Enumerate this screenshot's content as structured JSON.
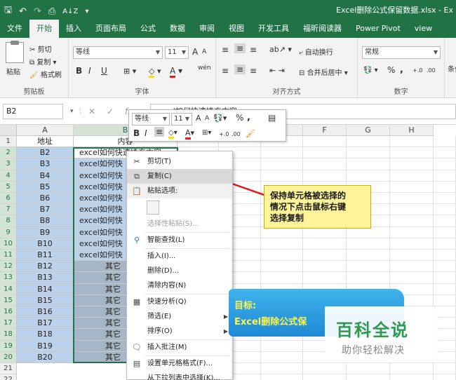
{
  "window": {
    "title": "Excel删除公式保留数据.xlsx - Ex"
  },
  "quick_access": {
    "save": "🖫",
    "undo": "↶",
    "redo": "↷",
    "preview": "⎙",
    "sort": "A↓Z",
    "more": "▾"
  },
  "tabs": [
    "文件",
    "开始",
    "插入",
    "页面布局",
    "公式",
    "数据",
    "审阅",
    "视图",
    "开发工具",
    "福昕阅读器",
    "Power Pivot",
    "view"
  ],
  "active_tab": 1,
  "ribbon": {
    "clipboard": {
      "paste": "粘贴",
      "cut": "剪切",
      "copy": "复制",
      "format_painter": "格式刷",
      "label": "剪贴板"
    },
    "font": {
      "name": "等线",
      "size": "11",
      "grow": "A",
      "shrink": "A",
      "bold": "B",
      "italic": "I",
      "underline": "U",
      "wen": "wén",
      "label": "字体"
    },
    "alignment": {
      "wrap": "自动换行",
      "merge": "合并后居中",
      "label": "对齐方式"
    },
    "number": {
      "format": "常规",
      "percent": "%",
      "comma": ",",
      "label": "数字"
    },
    "styles": {
      "cond": "条件"
    }
  },
  "formula_bar": {
    "name_box": "B2",
    "content": "excel如何快速填充内容"
  },
  "columns": [
    "A",
    "B",
    "C",
    "D",
    "E",
    "F",
    "G",
    "H"
  ],
  "rows": [
    "1",
    "2",
    "3",
    "4",
    "5",
    "6",
    "7",
    "8",
    "9",
    "10",
    "11",
    "12",
    "13",
    "14",
    "15",
    "16",
    "17",
    "18",
    "19",
    "20",
    "21",
    "22"
  ],
  "sheet": {
    "colA": [
      "地址",
      "B2",
      "B3",
      "B4",
      "B5",
      "B6",
      "B7",
      "B8",
      "B9",
      "B10",
      "B11",
      "B12",
      "B13",
      "B14",
      "B15",
      "B16",
      "B17",
      "B18",
      "B19",
      "B20"
    ],
    "colB": [
      "内容",
      "excel如何快速填充内容",
      "excel如何快",
      "excel如何快",
      "excel如何快",
      "excel如何快",
      "excel如何快",
      "excel如何快",
      "excel如何快",
      "excel如何快",
      "excel如何快",
      "其它",
      "其它",
      "其它",
      "其它",
      "其它",
      "其它",
      "其它",
      "其它",
      "其它"
    ]
  },
  "mini_toolbar": {
    "font": "等线",
    "size": "11",
    "grow": "A",
    "shrink": "A",
    "bold": "B",
    "italic": "I",
    "percent": "%",
    "comma": ","
  },
  "context_menu": {
    "cut": "剪切(T)",
    "copy": "复制(C)",
    "paste_options": "粘贴选项:",
    "paste_special": "选择性粘贴(S)...",
    "smart_lookup": "智能查找(L)",
    "insert": "插入(I)...",
    "delete": "删除(D)...",
    "clear": "清除内容(N)",
    "quick_analysis": "快速分析(Q)",
    "filter": "筛选(E)",
    "sort": "排序(O)",
    "insert_comment": "插入批注(M)",
    "format_cells": "设置单元格格式(F)...",
    "pick_list": "从下拉列表中选择(K)..."
  },
  "callout": {
    "line1": "保持单元格被选择的",
    "line2": "情况下点击鼠标右键",
    "line3": "选择复制"
  },
  "banner": {
    "line1": "目标:",
    "line2": "Excel删除公式保"
  },
  "watermark": {
    "line1": "百科全说",
    "line2": "助你轻松解决"
  },
  "colors": {
    "excel_green": "#217346",
    "selection": "#bcd1ea",
    "arrow": "#e01818",
    "callout_bg": "#fff39a"
  }
}
